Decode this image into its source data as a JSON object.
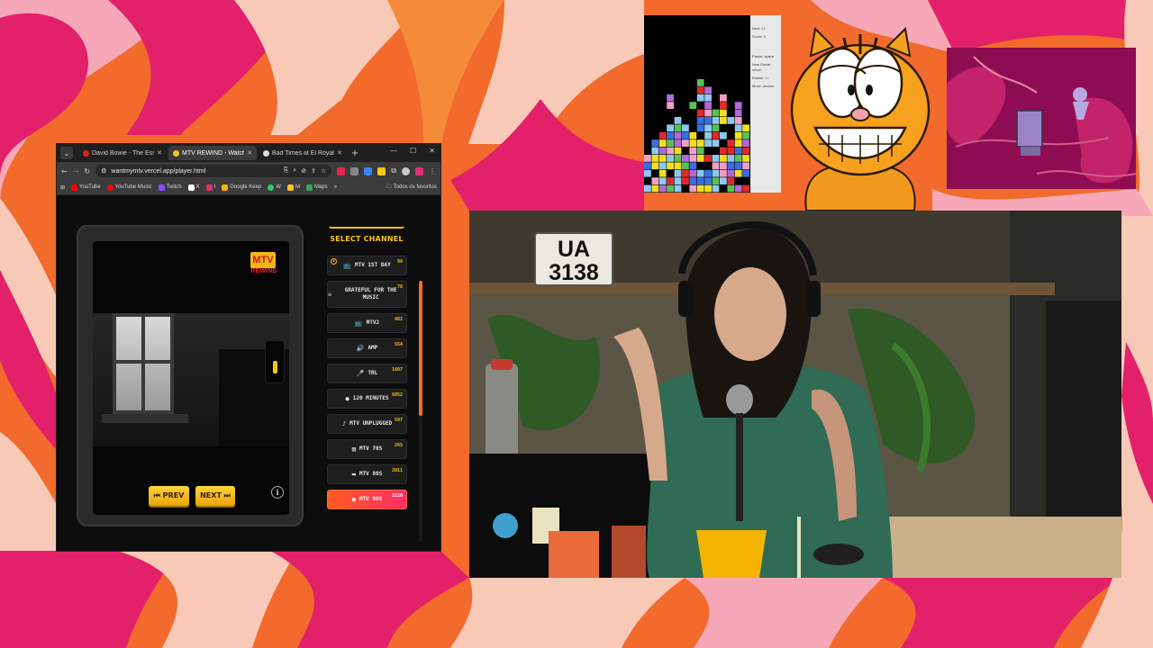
{
  "browser": {
    "tabs": [
      {
        "title": "David Bowie - The Essenti",
        "active": false,
        "favicon_color": "#e02020"
      },
      {
        "title": "MTV REWIND - Watch",
        "active": true,
        "favicon_color": "#f5c518"
      },
      {
        "title": "Bad Times at El Royale - …",
        "active": false,
        "favicon_color": "#dddddd"
      }
    ],
    "url": "wantmymtv.vercel.app/player.html",
    "bookmarks": [
      {
        "label": "YouTube",
        "icon": "youtube-icon",
        "color": "#ff0000"
      },
      {
        "label": "YouTube Music",
        "icon": "youtube-music-icon",
        "color": "#ff0000"
      },
      {
        "label": "Twitch",
        "icon": "twitch-icon",
        "color": "#9146ff"
      },
      {
        "label": "X",
        "icon": "x-icon",
        "color": "#ffffff"
      },
      {
        "label": "I",
        "icon": "instagram-icon",
        "color": "#e1306c"
      },
      {
        "label": "Google Keep",
        "icon": "keep-icon",
        "color": "#f7b500"
      },
      {
        "label": "W",
        "icon": "whatsapp-icon",
        "color": "#25d366"
      },
      {
        "label": "M",
        "icon": "m-icon",
        "color": "#f5c518"
      },
      {
        "label": "Maps",
        "icon": "maps-icon",
        "color": "#34a853"
      }
    ],
    "bookmarks_more": "»",
    "all_bookmarks": "Todos os favoritos"
  },
  "player": {
    "logo_text": "MTV",
    "logo_subtext": "REWIND",
    "prev_label": "⏮ PREV",
    "next_label": "NEXT ⏭",
    "info_label": "i"
  },
  "channels": {
    "title": "SELECT CHANNEL",
    "items": [
      {
        "label": "MTV 1ST DAY",
        "count": "96",
        "icon": "📺",
        "favorite": true
      },
      {
        "label": "GRATEFUL FOR THE MUSIC",
        "count": "76",
        "icon": "☠",
        "favorite": false
      },
      {
        "label": "MTV2",
        "count": "482",
        "icon": "📺",
        "favorite": false
      },
      {
        "label": "AMP",
        "count": "554",
        "icon": "🔊",
        "favorite": false
      },
      {
        "label": "TRL",
        "count": "1607",
        "icon": "🎤",
        "favorite": false
      },
      {
        "label": "120 MINUTES",
        "count": "6052",
        "icon": "●",
        "favorite": false
      },
      {
        "label": "MTV UNPLUGGED",
        "count": "597",
        "icon": "♪",
        "favorite": false
      },
      {
        "label": "MTV 70S",
        "count": "265",
        "icon": "▨",
        "favorite": false
      },
      {
        "label": "MTV 80S",
        "count": "2811",
        "icon": "▬",
        "favorite": false
      },
      {
        "label": "MTV 90S",
        "count": "3220",
        "icon": "●",
        "favorite": false,
        "active": true
      }
    ]
  },
  "tetris": {
    "next": "Next: L1",
    "score": "Score: 9",
    "controls": [
      "Pause: space",
      "New Game: return",
      "Rotate: ↑/↓",
      "Move: arrows"
    ]
  },
  "webcam": {
    "plate_line1": "UA",
    "plate_line2": "3138"
  },
  "colors": {
    "accent": "#f5c518",
    "active_channel_from": "#ff5b1f",
    "active_channel_to": "#ff2d6a"
  }
}
